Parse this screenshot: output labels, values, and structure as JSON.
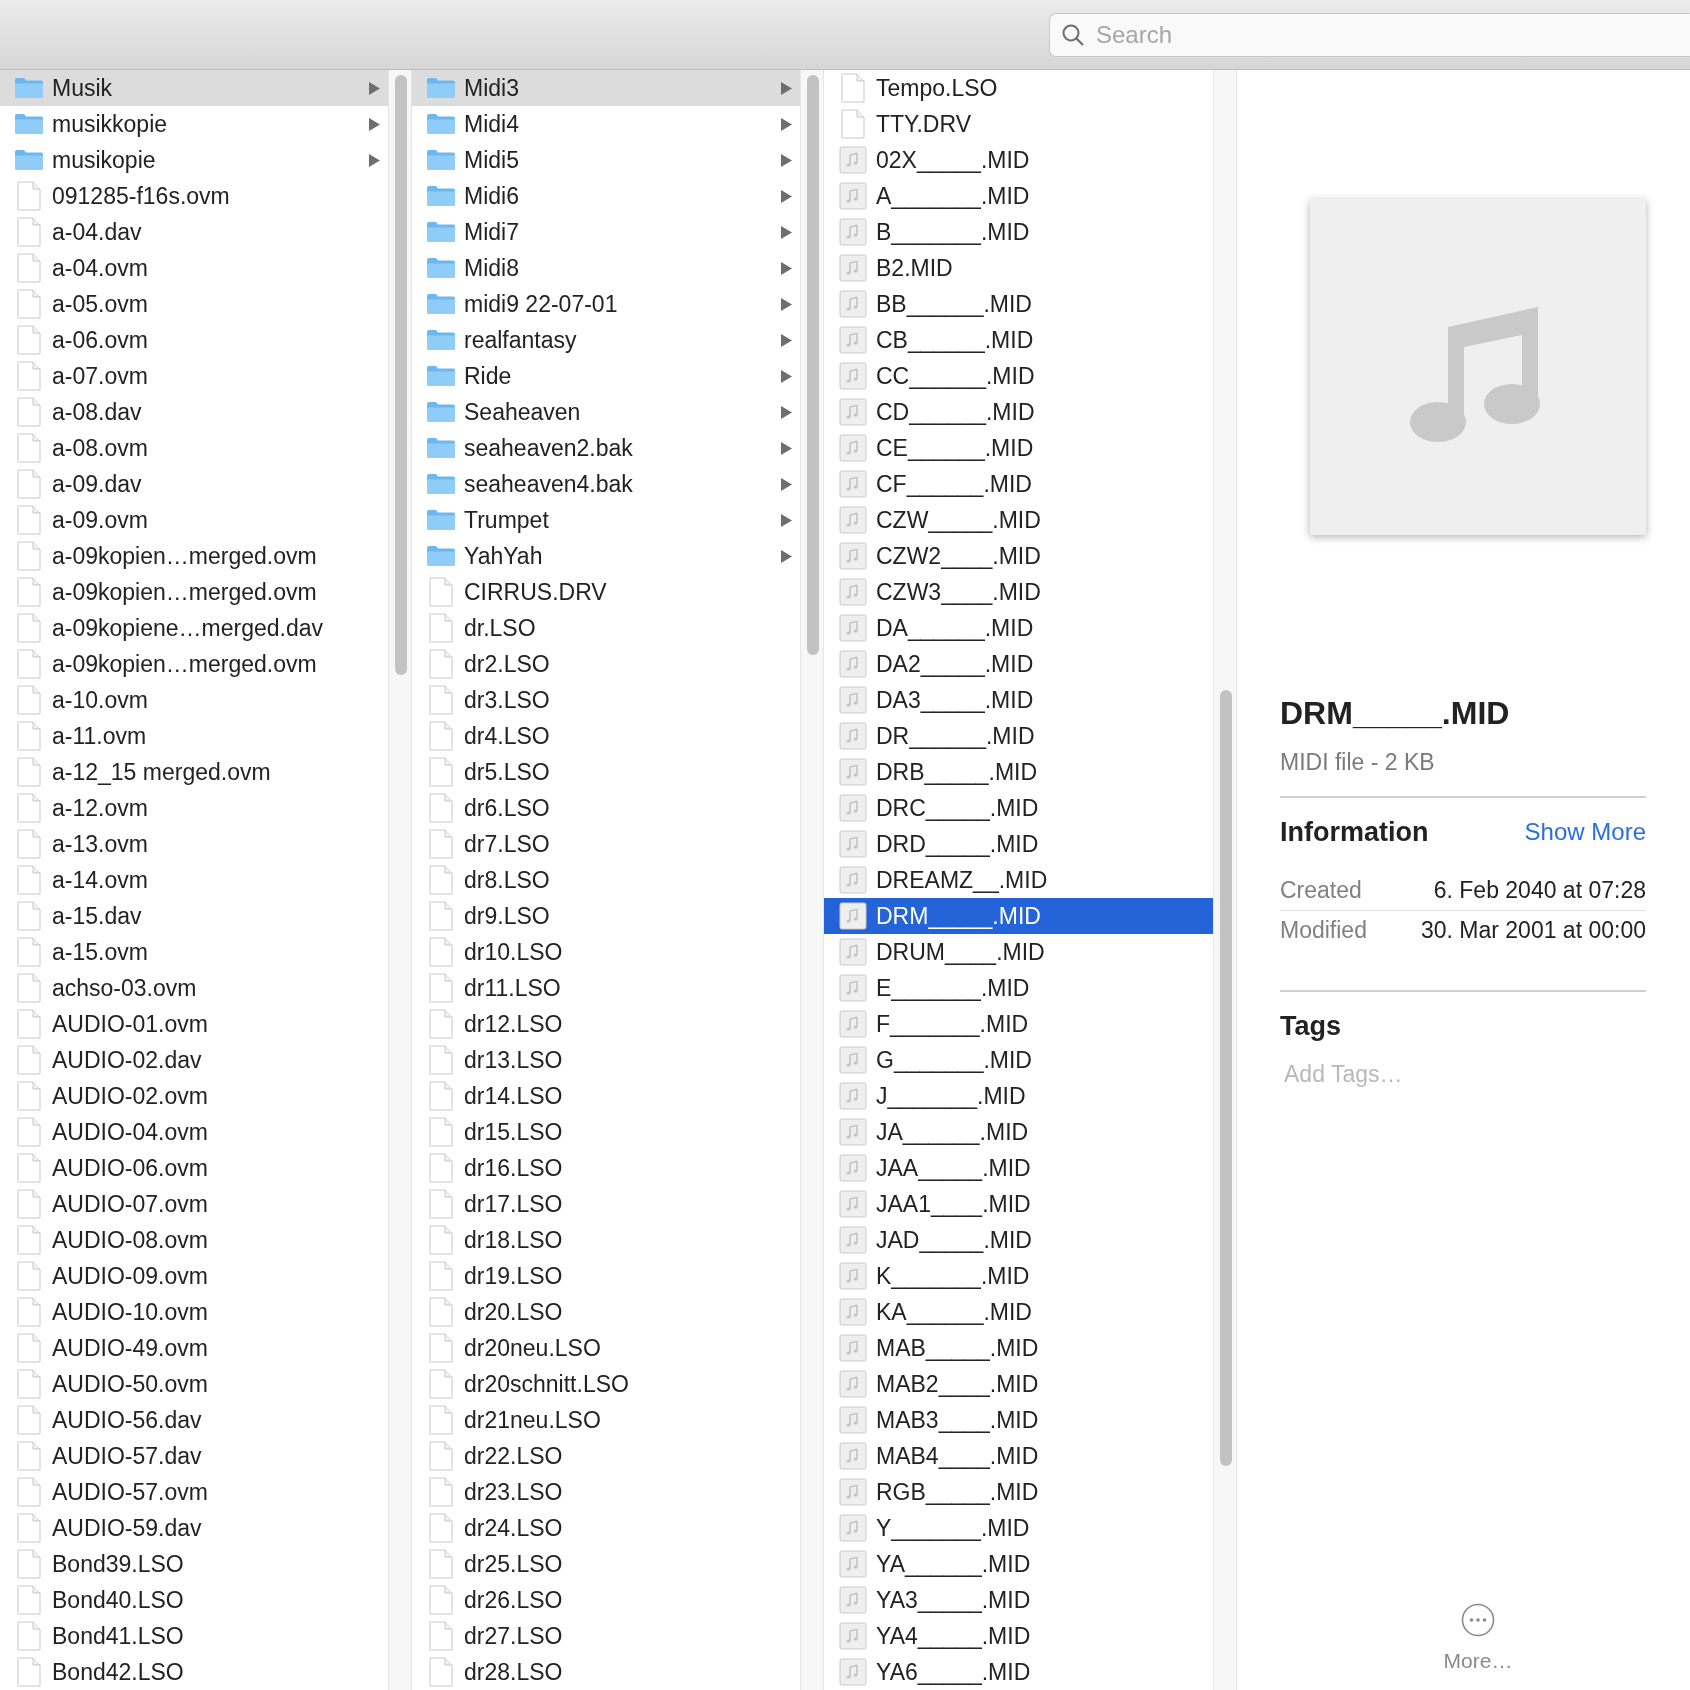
{
  "search": {
    "placeholder": "Search"
  },
  "columns": [
    {
      "focused": false,
      "items": [
        {
          "kind": "folder",
          "name": "Musik",
          "selected": true
        },
        {
          "kind": "folder",
          "name": "musikkopie",
          "selected": false
        },
        {
          "kind": "folder",
          "name": "musikopie",
          "selected": false
        },
        {
          "kind": "file",
          "name": "091285-f16s.ovm",
          "selected": false
        },
        {
          "kind": "file",
          "name": "a-04.dav",
          "selected": false
        },
        {
          "kind": "file",
          "name": "a-04.ovm",
          "selected": false
        },
        {
          "kind": "file",
          "name": "a-05.ovm",
          "selected": false
        },
        {
          "kind": "file",
          "name": "a-06.ovm",
          "selected": false
        },
        {
          "kind": "file",
          "name": "a-07.ovm",
          "selected": false
        },
        {
          "kind": "file",
          "name": "a-08.dav",
          "selected": false
        },
        {
          "kind": "file",
          "name": "a-08.ovm",
          "selected": false
        },
        {
          "kind": "file",
          "name": "a-09.dav",
          "selected": false
        },
        {
          "kind": "file",
          "name": "a-09.ovm",
          "selected": false
        },
        {
          "kind": "file",
          "name": "a-09kopien…merged.ovm",
          "selected": false
        },
        {
          "kind": "file",
          "name": "a-09kopien…merged.ovm",
          "selected": false
        },
        {
          "kind": "file",
          "name": "a-09kopiene…merged.dav",
          "selected": false
        },
        {
          "kind": "file",
          "name": "a-09kopien…merged.ovm",
          "selected": false
        },
        {
          "kind": "file",
          "name": "a-10.ovm",
          "selected": false
        },
        {
          "kind": "file",
          "name": "a-11.ovm",
          "selected": false
        },
        {
          "kind": "file",
          "name": "a-12_15 merged.ovm",
          "selected": false
        },
        {
          "kind": "file",
          "name": "a-12.ovm",
          "selected": false
        },
        {
          "kind": "file",
          "name": "a-13.ovm",
          "selected": false
        },
        {
          "kind": "file",
          "name": "a-14.ovm",
          "selected": false
        },
        {
          "kind": "file",
          "name": "a-15.dav",
          "selected": false
        },
        {
          "kind": "file",
          "name": "a-15.ovm",
          "selected": false
        },
        {
          "kind": "file",
          "name": "achso-03.ovm",
          "selected": false
        },
        {
          "kind": "file",
          "name": "AUDIO-01.ovm",
          "selected": false
        },
        {
          "kind": "file",
          "name": "AUDIO-02.dav",
          "selected": false
        },
        {
          "kind": "file",
          "name": "AUDIO-02.ovm",
          "selected": false
        },
        {
          "kind": "file",
          "name": "AUDIO-04.ovm",
          "selected": false
        },
        {
          "kind": "file",
          "name": "AUDIO-06.ovm",
          "selected": false
        },
        {
          "kind": "file",
          "name": "AUDIO-07.ovm",
          "selected": false
        },
        {
          "kind": "file",
          "name": "AUDIO-08.ovm",
          "selected": false
        },
        {
          "kind": "file",
          "name": "AUDIO-09.ovm",
          "selected": false
        },
        {
          "kind": "file",
          "name": "AUDIO-10.ovm",
          "selected": false
        },
        {
          "kind": "file",
          "name": "AUDIO-49.ovm",
          "selected": false
        },
        {
          "kind": "file",
          "name": "AUDIO-50.ovm",
          "selected": false
        },
        {
          "kind": "file",
          "name": "AUDIO-56.dav",
          "selected": false
        },
        {
          "kind": "file",
          "name": "AUDIO-57.dav",
          "selected": false
        },
        {
          "kind": "file",
          "name": "AUDIO-57.ovm",
          "selected": false
        },
        {
          "kind": "file",
          "name": "AUDIO-59.dav",
          "selected": false
        },
        {
          "kind": "file",
          "name": "Bond39.LSO",
          "selected": false
        },
        {
          "kind": "file",
          "name": "Bond40.LSO",
          "selected": false
        },
        {
          "kind": "file",
          "name": "Bond41.LSO",
          "selected": false
        },
        {
          "kind": "file",
          "name": "Bond42.LSO",
          "selected": false
        }
      ]
    },
    {
      "focused": false,
      "items": [
        {
          "kind": "folder",
          "name": "Midi3",
          "selected": true
        },
        {
          "kind": "folder",
          "name": "Midi4",
          "selected": false
        },
        {
          "kind": "folder",
          "name": "Midi5",
          "selected": false
        },
        {
          "kind": "folder",
          "name": "Midi6",
          "selected": false
        },
        {
          "kind": "folder",
          "name": "Midi7",
          "selected": false
        },
        {
          "kind": "folder",
          "name": "Midi8",
          "selected": false
        },
        {
          "kind": "folder",
          "name": "midi9 22-07-01",
          "selected": false
        },
        {
          "kind": "folder",
          "name": "realfantasy",
          "selected": false
        },
        {
          "kind": "folder",
          "name": "Ride",
          "selected": false
        },
        {
          "kind": "folder",
          "name": "Seaheaven",
          "selected": false
        },
        {
          "kind": "folder",
          "name": "seaheaven2.bak",
          "selected": false
        },
        {
          "kind": "folder",
          "name": "seaheaven4.bak",
          "selected": false
        },
        {
          "kind": "folder",
          "name": "Trumpet",
          "selected": false
        },
        {
          "kind": "folder",
          "name": "YahYah",
          "selected": false
        },
        {
          "kind": "file",
          "name": "CIRRUS.DRV",
          "selected": false
        },
        {
          "kind": "file",
          "name": "dr.LSO",
          "selected": false
        },
        {
          "kind": "file",
          "name": "dr2.LSO",
          "selected": false
        },
        {
          "kind": "file",
          "name": "dr3.LSO",
          "selected": false
        },
        {
          "kind": "file",
          "name": "dr4.LSO",
          "selected": false
        },
        {
          "kind": "file",
          "name": "dr5.LSO",
          "selected": false
        },
        {
          "kind": "file",
          "name": "dr6.LSO",
          "selected": false
        },
        {
          "kind": "file",
          "name": "dr7.LSO",
          "selected": false
        },
        {
          "kind": "file",
          "name": "dr8.LSO",
          "selected": false
        },
        {
          "kind": "file",
          "name": "dr9.LSO",
          "selected": false
        },
        {
          "kind": "file",
          "name": "dr10.LSO",
          "selected": false
        },
        {
          "kind": "file",
          "name": "dr11.LSO",
          "selected": false
        },
        {
          "kind": "file",
          "name": "dr12.LSO",
          "selected": false
        },
        {
          "kind": "file",
          "name": "dr13.LSO",
          "selected": false
        },
        {
          "kind": "file",
          "name": "dr14.LSO",
          "selected": false
        },
        {
          "kind": "file",
          "name": "dr15.LSO",
          "selected": false
        },
        {
          "kind": "file",
          "name": "dr16.LSO",
          "selected": false
        },
        {
          "kind": "file",
          "name": "dr17.LSO",
          "selected": false
        },
        {
          "kind": "file",
          "name": "dr18.LSO",
          "selected": false
        },
        {
          "kind": "file",
          "name": "dr19.LSO",
          "selected": false
        },
        {
          "kind": "file",
          "name": "dr20.LSO",
          "selected": false
        },
        {
          "kind": "file",
          "name": "dr20neu.LSO",
          "selected": false
        },
        {
          "kind": "file",
          "name": "dr20schnitt.LSO",
          "selected": false
        },
        {
          "kind": "file",
          "name": "dr21neu.LSO",
          "selected": false
        },
        {
          "kind": "file",
          "name": "dr22.LSO",
          "selected": false
        },
        {
          "kind": "file",
          "name": "dr23.LSO",
          "selected": false
        },
        {
          "kind": "file",
          "name": "dr24.LSO",
          "selected": false
        },
        {
          "kind": "file",
          "name": "dr25.LSO",
          "selected": false
        },
        {
          "kind": "file",
          "name": "dr26.LSO",
          "selected": false
        },
        {
          "kind": "file",
          "name": "dr27.LSO",
          "selected": false
        },
        {
          "kind": "file",
          "name": "dr28.LSO",
          "selected": false
        }
      ]
    },
    {
      "focused": true,
      "items": [
        {
          "kind": "file",
          "name": "Tempo.LSO",
          "selected": false
        },
        {
          "kind": "file",
          "name": "TTY.DRV",
          "selected": false
        },
        {
          "kind": "midi",
          "name": "02X_____.MID",
          "selected": false
        },
        {
          "kind": "midi",
          "name": "A_______.MID",
          "selected": false
        },
        {
          "kind": "midi",
          "name": "B_______.MID",
          "selected": false
        },
        {
          "kind": "midi",
          "name": "B2.MID",
          "selected": false
        },
        {
          "kind": "midi",
          "name": "BB______.MID",
          "selected": false
        },
        {
          "kind": "midi",
          "name": "CB______.MID",
          "selected": false
        },
        {
          "kind": "midi",
          "name": "CC______.MID",
          "selected": false
        },
        {
          "kind": "midi",
          "name": "CD______.MID",
          "selected": false
        },
        {
          "kind": "midi",
          "name": "CE______.MID",
          "selected": false
        },
        {
          "kind": "midi",
          "name": "CF______.MID",
          "selected": false
        },
        {
          "kind": "midi",
          "name": "CZW_____.MID",
          "selected": false
        },
        {
          "kind": "midi",
          "name": "CZW2____.MID",
          "selected": false
        },
        {
          "kind": "midi",
          "name": "CZW3____.MID",
          "selected": false
        },
        {
          "kind": "midi",
          "name": "DA______.MID",
          "selected": false
        },
        {
          "kind": "midi",
          "name": "DA2_____.MID",
          "selected": false
        },
        {
          "kind": "midi",
          "name": "DA3_____.MID",
          "selected": false
        },
        {
          "kind": "midi",
          "name": "DR______.MID",
          "selected": false
        },
        {
          "kind": "midi",
          "name": "DRB_____.MID",
          "selected": false
        },
        {
          "kind": "midi",
          "name": "DRC_____.MID",
          "selected": false
        },
        {
          "kind": "midi",
          "name": "DRD_____.MID",
          "selected": false
        },
        {
          "kind": "midi",
          "name": "DREAMZ__.MID",
          "selected": false
        },
        {
          "kind": "midi",
          "name": "DRM_____.MID",
          "selected": true
        },
        {
          "kind": "midi",
          "name": "DRUM____.MID",
          "selected": false
        },
        {
          "kind": "midi",
          "name": "E_______.MID",
          "selected": false
        },
        {
          "kind": "midi",
          "name": "F_______.MID",
          "selected": false
        },
        {
          "kind": "midi",
          "name": "G_______.MID",
          "selected": false
        },
        {
          "kind": "midi",
          "name": "J_______.MID",
          "selected": false
        },
        {
          "kind": "midi",
          "name": "JA______.MID",
          "selected": false
        },
        {
          "kind": "midi",
          "name": "JAA_____.MID",
          "selected": false
        },
        {
          "kind": "midi",
          "name": "JAA1____.MID",
          "selected": false
        },
        {
          "kind": "midi",
          "name": "JAD_____.MID",
          "selected": false
        },
        {
          "kind": "midi",
          "name": "K_______.MID",
          "selected": false
        },
        {
          "kind": "midi",
          "name": "KA______.MID",
          "selected": false
        },
        {
          "kind": "midi",
          "name": "MAB_____.MID",
          "selected": false
        },
        {
          "kind": "midi",
          "name": "MAB2____.MID",
          "selected": false
        },
        {
          "kind": "midi",
          "name": "MAB3____.MID",
          "selected": false
        },
        {
          "kind": "midi",
          "name": "MAB4____.MID",
          "selected": false
        },
        {
          "kind": "midi",
          "name": "RGB_____.MID",
          "selected": false
        },
        {
          "kind": "midi",
          "name": "Y_______.MID",
          "selected": false
        },
        {
          "kind": "midi",
          "name": "YA______.MID",
          "selected": false
        },
        {
          "kind": "midi",
          "name": "YA3_____.MID",
          "selected": false
        },
        {
          "kind": "midi",
          "name": "YA4_____.MID",
          "selected": false
        },
        {
          "kind": "midi",
          "name": "YA6_____.MID",
          "selected": false
        }
      ]
    }
  ],
  "preview": {
    "title": "DRM_____.MID",
    "subtitle": "MIDI file - 2 KB",
    "info_heading": "Information",
    "show_more": "Show More",
    "fields": [
      {
        "label": "Created",
        "value": "6. Feb 2040 at 07:28"
      },
      {
        "label": "Modified",
        "value": "30. Mar 2001 at 00:00"
      }
    ],
    "tags_heading": "Tags",
    "tags_placeholder": "Add Tags…",
    "more_label": "More…"
  }
}
